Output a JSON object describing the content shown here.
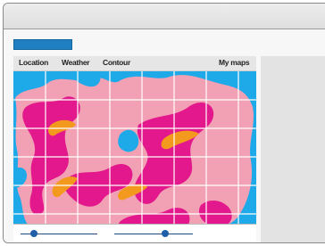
{
  "nav": {
    "location": "Location",
    "weather": "Weather",
    "contour": "Contour",
    "mymaps": "My maps"
  },
  "colors": {
    "water": "#1ea9e8",
    "land": "#f2a0b4",
    "dense": "#e3188c",
    "peak": "#f39a1e",
    "accent": "#1f7fc0"
  },
  "sliders": [
    {
      "name": "slider-1",
      "value": 0.18
    },
    {
      "name": "slider-2",
      "value": 0.65
    }
  ]
}
